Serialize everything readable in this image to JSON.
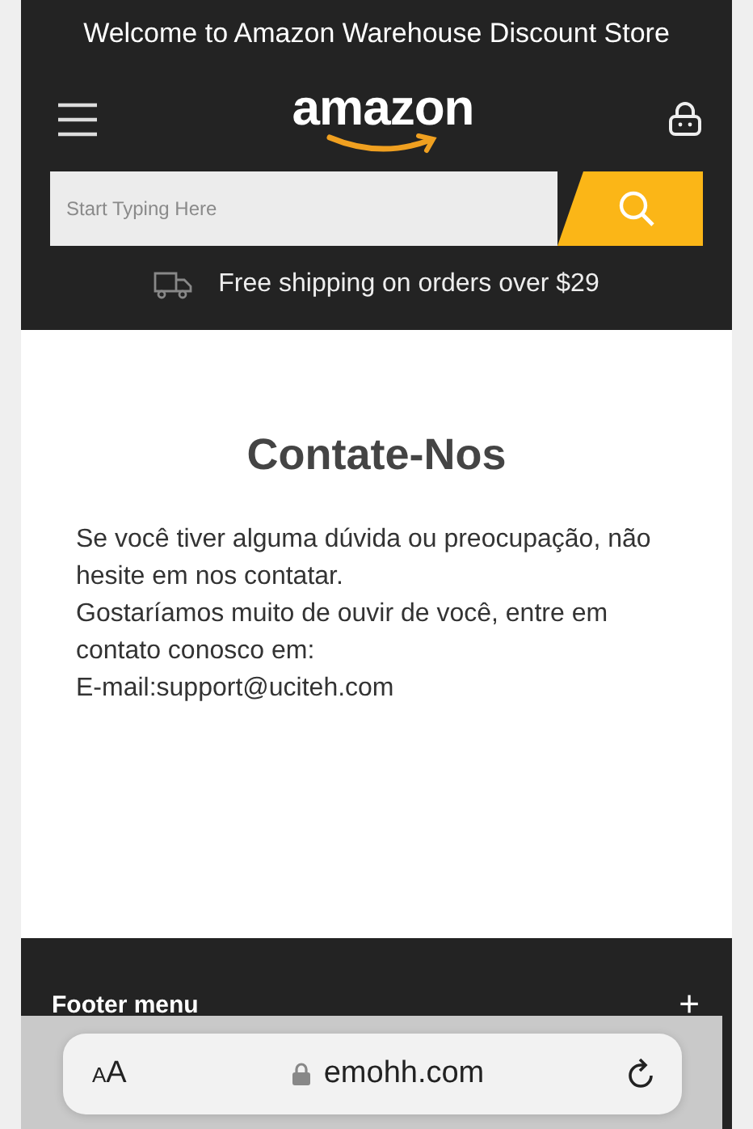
{
  "banner": {
    "text": "Welcome to Amazon Warehouse Discount Store"
  },
  "nav": {
    "logo": "amazon"
  },
  "search": {
    "placeholder": "Start Typing Here"
  },
  "shipping": {
    "text": "Free shipping on orders over $29"
  },
  "contact": {
    "title": "Contate-Nos",
    "paragraphs": [
      "Se você tiver alguma dúvida ou preocupação, não hesite em nos contatar.",
      "Gostaríamos muito de ouvir de você, entre em contato conosco em:",
      "E-mail:support@uciteh.com"
    ]
  },
  "footer": {
    "menu_label": "Footer menu",
    "expand": "+"
  },
  "browser_bar": {
    "text_size": "AA",
    "url": "emohh.com"
  }
}
